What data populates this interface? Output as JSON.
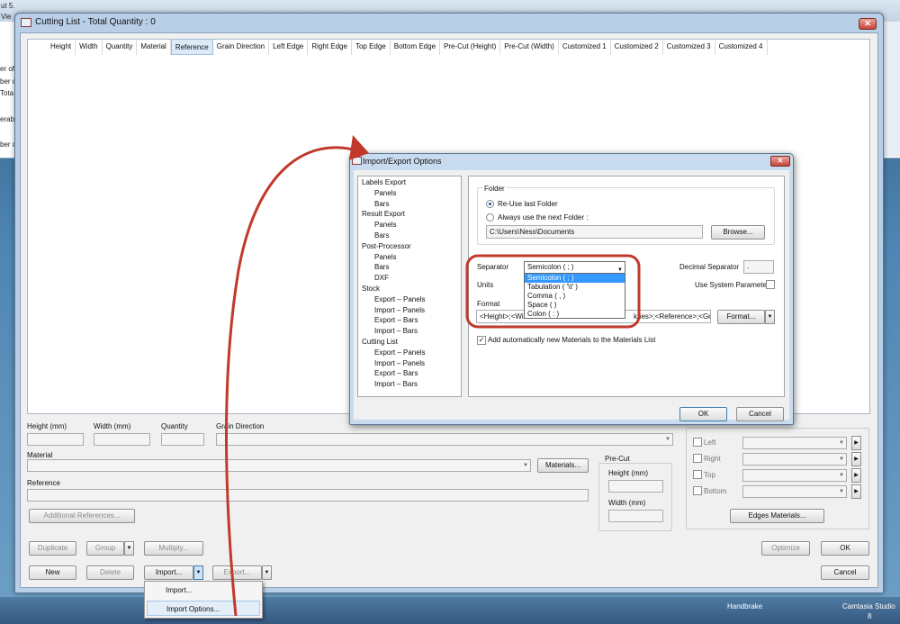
{
  "background": {
    "partial_lines": [
      "ut 5.",
      "Vie",
      "er of",
      "ber c",
      "Tota",
      "erab",
      "ber c"
    ]
  },
  "window": {
    "title": "Cutting List - Total Quantity : 0",
    "close_glyph": "✕"
  },
  "grid": {
    "columns": [
      "Height",
      "Width",
      "Quantity",
      "Material",
      "Reference",
      "Grain Direction",
      "Left Edge",
      "Right Edge",
      "Top Edge",
      "Bottom Edge",
      "Pre-Cut (Height)",
      "Pre-Cut (Width)",
      "Customized 1",
      "Customized 2",
      "Customized 3",
      "Customized 4"
    ],
    "selected_column": "Reference"
  },
  "form": {
    "height_label": "Height (mm)",
    "width_label": "Width (mm)",
    "quantity_label": "Quantity",
    "grain_label": "Grain Direction",
    "material_label": "Material",
    "materials_button": "Materials...",
    "reference_label": "Reference",
    "additional_references_button": "Additional References...",
    "precut": {
      "title": "Pre-Cut",
      "height_label": "Height (mm)",
      "width_label": "Width (mm)"
    },
    "edges": {
      "left": "Left",
      "right": "Right",
      "top": "Top",
      "bottom": "Bottom",
      "materials_button": "Edges Materials..."
    }
  },
  "toolbar": {
    "duplicate": "Duplicate",
    "group": "Group",
    "multiply": "Multiply...",
    "new": "New",
    "delete": "Delete",
    "import": "Import...",
    "export": "Export...",
    "optimize": "Optimize",
    "ok": "OK",
    "cancel": "Cancel"
  },
  "context_menu": {
    "items": [
      "Import...",
      "Import Options..."
    ],
    "hover_index": 1
  },
  "dialog": {
    "title": "Import/Export Options",
    "close_glyph": "✕",
    "tree": [
      {
        "label": "Labels Export",
        "level": 0
      },
      {
        "label": "Panels",
        "level": 1
      },
      {
        "label": "Bars",
        "level": 1
      },
      {
        "label": "Result Export",
        "level": 0
      },
      {
        "label": "Panels",
        "level": 1
      },
      {
        "label": "Bars",
        "level": 1
      },
      {
        "label": "Post-Processor",
        "level": 0
      },
      {
        "label": "Panels",
        "level": 1
      },
      {
        "label": "Bars",
        "level": 1
      },
      {
        "label": "DXF",
        "level": 1
      },
      {
        "label": "Stock",
        "level": 0
      },
      {
        "label": "Export – Panels",
        "level": 1
      },
      {
        "label": "Import – Panels",
        "level": 1
      },
      {
        "label": "Export – Bars",
        "level": 1
      },
      {
        "label": "Import – Bars",
        "level": 1
      },
      {
        "label": "Cutting List",
        "level": 0
      },
      {
        "label": "Export – Panels",
        "level": 1
      },
      {
        "label": "Import – Panels",
        "level": 1
      },
      {
        "label": "Export – Bars",
        "level": 1
      },
      {
        "label": "Import – Bars",
        "level": 1
      }
    ],
    "folder": {
      "title": "Folder",
      "reuse_label": "Re-Use last Folder",
      "always_label": "Always use the next Folder :",
      "selected": "reuse",
      "path": "C:\\Users\\Ness\\Documents",
      "browse_button": "Browse..."
    },
    "separator": {
      "label": "Separator",
      "value": "Semicolon  ( ; )",
      "options": [
        "Semicolon  ( ; )",
        "Tabulation  ( '\\t' )",
        "Comma  ( , )",
        "Space  (   )",
        "Colon  ( : )"
      ],
      "highlighted_index": 0
    },
    "decimal_label": "Decimal Separator",
    "decimal_value": ".",
    "units_label": "Units",
    "system_param_label": "Use System Parameter",
    "format_label": "Format",
    "format_left": "<Height>;<Wid",
    "format_mid": "knes>;<Reference>;<Gra",
    "format_button": "Format...",
    "add_materials_label": "Add automatically new Materials to the Materials List",
    "add_materials_checked": true,
    "ok": "OK",
    "cancel": "Cancel"
  },
  "taskbar": {
    "items": [
      "Handbrake",
      "Camtasia Studio",
      "8"
    ]
  },
  "colors": {
    "arrow": "#c0392b",
    "highlight": "#3399ff",
    "circle": "#c0392b"
  }
}
